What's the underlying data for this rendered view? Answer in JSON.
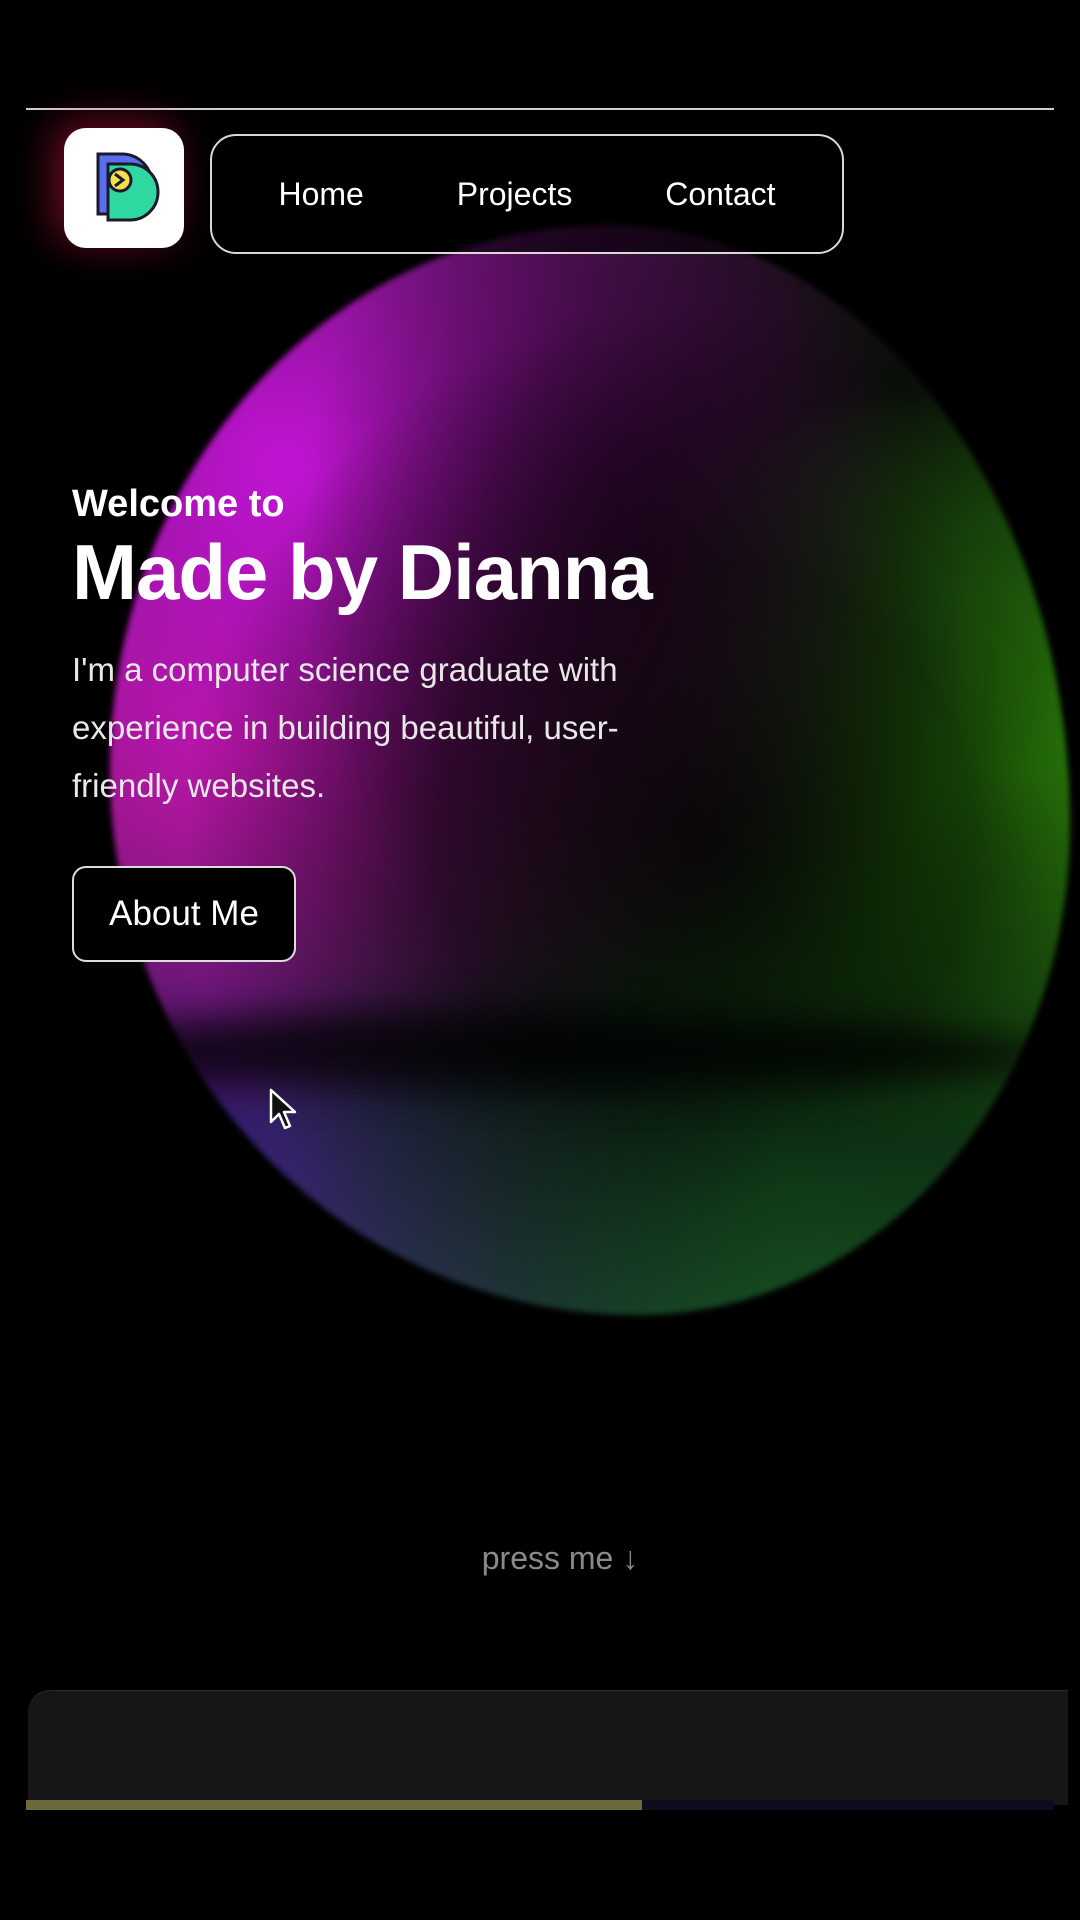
{
  "brand": {
    "logo_icon": "d-letter-logo-icon",
    "logo_colors": [
      "#5a6ff0",
      "#2ed8a0",
      "#f4e04d"
    ]
  },
  "nav": {
    "items": [
      {
        "label": "Home"
      },
      {
        "label": "Projects"
      },
      {
        "label": "Contact"
      }
    ]
  },
  "hero": {
    "kicker": "Welcome to",
    "title": "Made by Dianna",
    "description": "I'm a computer science graduate with experience in building beautiful, user-friendly websites.",
    "cta_label": "About Me"
  },
  "scroll_hint": {
    "label": "press me ↓"
  },
  "colors": {
    "background": "#000000",
    "blob_magenta": "#c214d4",
    "blob_green": "#3fbf10",
    "border": "#d9d9d9"
  },
  "cursor_icon": "arrow-pointer-icon"
}
